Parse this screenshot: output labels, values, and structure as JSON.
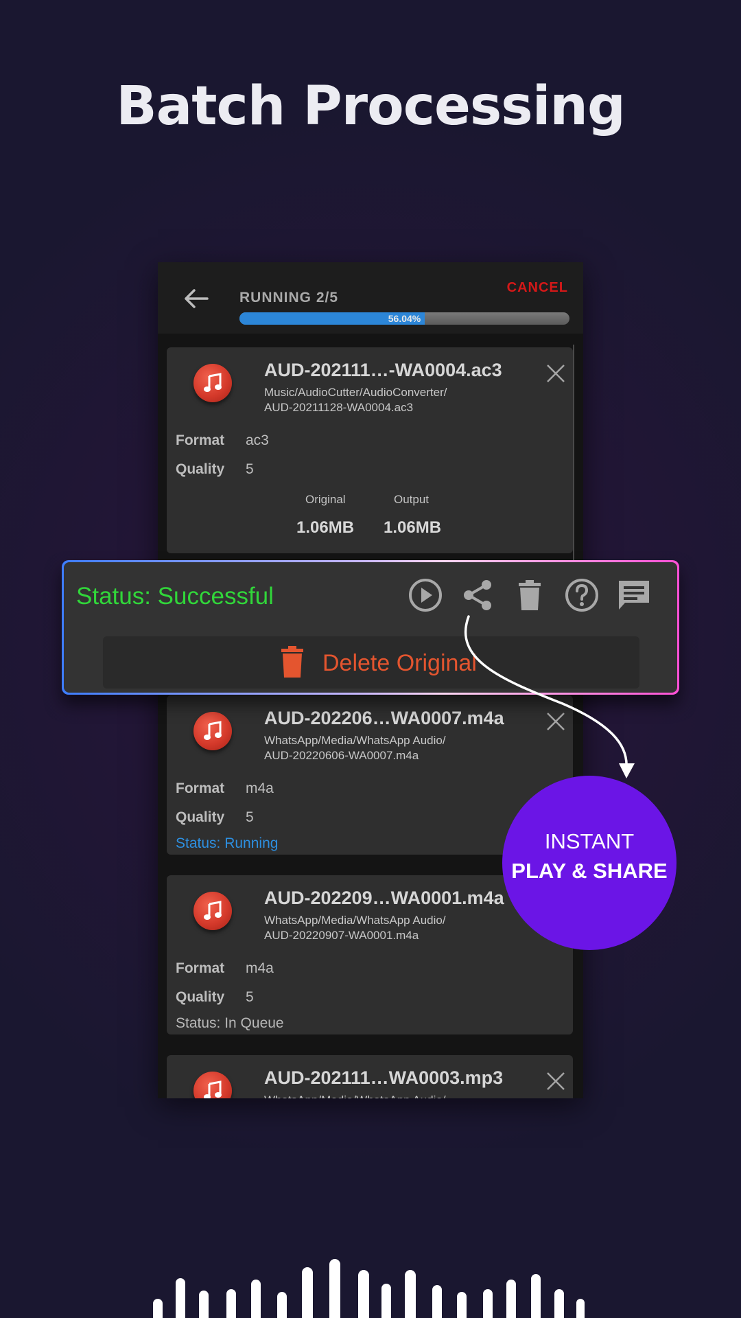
{
  "headline": "Batch Processing",
  "app_bar": {
    "title": "RUNNING 2/5",
    "cancel_label": "CANCEL",
    "progress_label": "56.04%",
    "progress_fraction": 0.5604
  },
  "cards": [
    {
      "file_name": "AUD-202111…-WA0004.ac3",
      "path_line1": "Music/AudioCutter/AudioConverter/",
      "path_line2": "AUD-20211128-WA0004.ac3",
      "format_label": "Format",
      "format_value": "ac3",
      "quality_label": "Quality",
      "quality_value": "5",
      "original_label": "Original",
      "output_label": "Output",
      "original_size": "1.06MB",
      "output_size": "1.06MB"
    },
    {
      "file_name": "AUD-202206…WA0007.m4a",
      "path_line1": "WhatsApp/Media/WhatsApp Audio/",
      "path_line2": "AUD-20220606-WA0007.m4a",
      "format_label": "Format",
      "format_value": "m4a",
      "quality_label": "Quality",
      "quality_value": "5",
      "status": "Status: Running",
      "status_color": "#2d8fe0"
    },
    {
      "file_name": "AUD-202209…WA0001.m4a",
      "path_line1": "WhatsApp/Media/WhatsApp Audio/",
      "path_line2": "AUD-20220907-WA0001.m4a",
      "format_label": "Format",
      "format_value": "m4a",
      "quality_label": "Quality",
      "quality_value": "5",
      "status": "Status: In Queue",
      "status_color": "#b8b8b8"
    },
    {
      "file_name": "AUD-202111…WA0003.mp3",
      "path_line1": "WhatsApp/Media/WhatsApp Audio/"
    }
  ],
  "status_panel": {
    "status": "Status: Successful",
    "status_color": "#31d63a",
    "actions": [
      "play-icon",
      "share-icon",
      "trash-icon",
      "help-icon",
      "comment-icon"
    ],
    "delete_label": "Delete Original",
    "delete_color": "#e4552f"
  },
  "callout": {
    "line1": "INSTANT",
    "line2": "PLAY & SHARE",
    "color": "#6b15e6"
  },
  "colors": {
    "accent_blue": "#2c86d8",
    "cancel_red": "#d31818",
    "icon_red": "#d53a2b"
  }
}
